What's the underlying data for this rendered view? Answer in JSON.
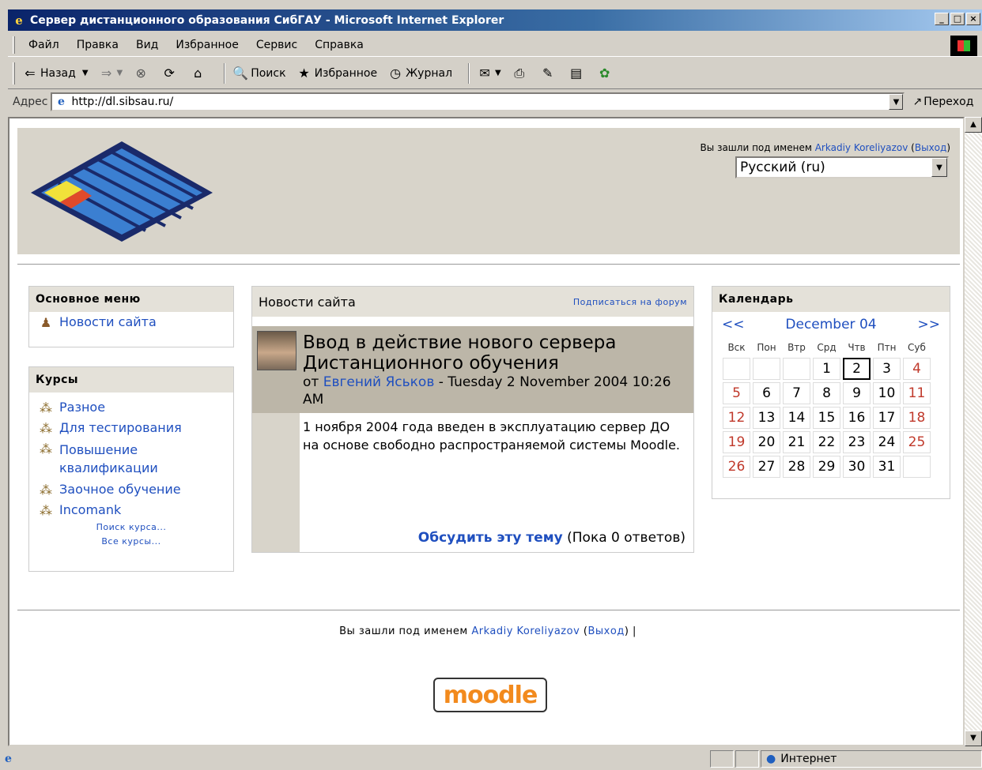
{
  "window": {
    "title": "Сервер дистанционного образования СибГАУ - Microsoft Internet Explorer"
  },
  "menubar": {
    "items": [
      "Файл",
      "Правка",
      "Вид",
      "Избранное",
      "Сервис",
      "Справка"
    ]
  },
  "toolbar": {
    "back": "Назад",
    "search": "Поиск",
    "favorites": "Избранное",
    "history": "Журнал"
  },
  "addressbar": {
    "label": "Адрес",
    "url": "http://dl.sibsau.ru/",
    "go": "Переход"
  },
  "header": {
    "login_prefix": "Вы зашли под именем",
    "user": "Arkadiy Koreliyazov",
    "logout": "Выход",
    "language": "Русский (ru)"
  },
  "main_menu": {
    "title": "Основное меню",
    "items": [
      "Новости сайта"
    ]
  },
  "courses": {
    "title": "Курсы",
    "items": [
      "Разное",
      "Для тестирования",
      "Повышение квалификации",
      "Заочное обучение",
      "Incomank"
    ],
    "search": "Поиск курса...",
    "all": "Все курсы..."
  },
  "news": {
    "title": "Новости сайта",
    "subscribe": "Подписаться на форум",
    "post": {
      "title": "Ввод в действие нового сервера Дистанционного обучения",
      "by": "от",
      "author": "Евгений Яськов",
      "date": "- Tuesday 2 November 2004 10:26 AM",
      "body": "1 ноября 2004 года введен в эксплуатацию сервер ДО на основе свободно распространяемой системы Moodle.",
      "discuss": "Обсудить эту тему",
      "replies": "(Пока 0 ответов)"
    }
  },
  "calendar": {
    "title": "Календарь",
    "prev": "<<",
    "next": ">>",
    "month": "December 04",
    "weekdays": [
      "Вск",
      "Пон",
      "Втр",
      "Срд",
      "Чтв",
      "Птн",
      "Суб"
    ],
    "weeks": [
      [
        "",
        "",
        "",
        "1",
        "2",
        "3",
        "4"
      ],
      [
        "5",
        "6",
        "7",
        "8",
        "9",
        "10",
        "11"
      ],
      [
        "12",
        "13",
        "14",
        "15",
        "16",
        "17",
        "18"
      ],
      [
        "19",
        "20",
        "21",
        "22",
        "23",
        "24",
        "25"
      ],
      [
        "26",
        "27",
        "28",
        "29",
        "30",
        "31",
        ""
      ]
    ],
    "today": "2"
  },
  "footer": {
    "login_prefix": "Вы зашли под именем",
    "user": "Arkadiy Koreliyazov",
    "logout": "Выход",
    "separator": "|"
  },
  "moodle_logo": "moodle",
  "statusbar": {
    "zone": "Интернет"
  },
  "colors": {
    "link": "#1f4fbf",
    "weekend": "#c0392b",
    "header_bg": "#d8d4ca"
  }
}
